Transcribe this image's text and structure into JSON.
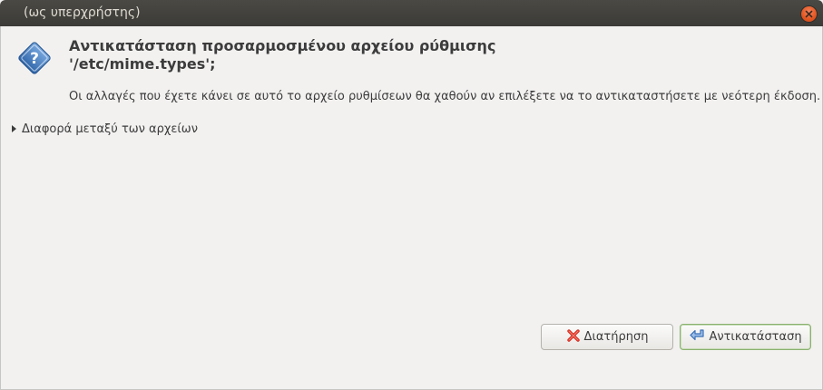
{
  "window": {
    "title": "(ως υπερχρήστης)"
  },
  "dialog": {
    "heading_line1": "Αντικατάσταση προσαρμοσμένου αρχείου ρύθμισης",
    "heading_line2": "'/etc/mime.types';",
    "message": "Οι αλλαγές που έχετε κάνει σε αυτό το αρχείο ρυθμίσεων θα χαθούν αν επιλέξετε να το αντικαταστήσετε με νεότερη έκδοση.",
    "expander_label": "Διαφορά μεταξύ των αρχείων"
  },
  "buttons": {
    "keep_label": "Διατήρηση",
    "replace_label": "Αντικατάσταση"
  },
  "icons": {
    "dialog_icon": "question-icon",
    "keep_icon": "red-x-icon",
    "replace_icon": "replace-arrow-icon",
    "close_icon": "close-icon"
  },
  "colors": {
    "titlebar": "#3c3b37",
    "close_button": "#e35520",
    "question_icon": "#3b72b5",
    "keep_icon": "#d8291d",
    "replace_icon": "#3a6fb7"
  }
}
